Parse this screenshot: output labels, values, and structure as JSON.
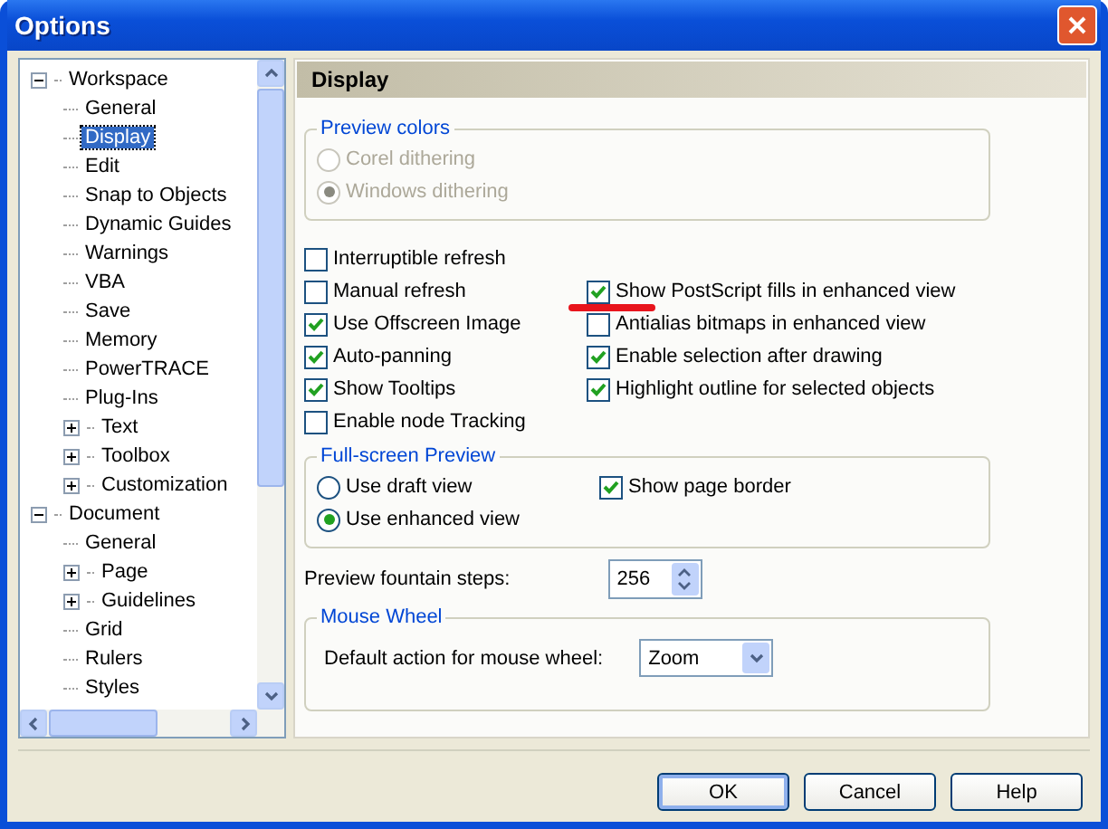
{
  "window": {
    "title": "Options"
  },
  "tree": [
    {
      "label": "Workspace",
      "expanded": true,
      "selected": false,
      "children": [
        {
          "label": "General",
          "selected": false
        },
        {
          "label": "Display",
          "selected": true
        },
        {
          "label": "Edit",
          "selected": false
        },
        {
          "label": "Snap to Objects",
          "selected": false
        },
        {
          "label": "Dynamic Guides",
          "selected": false
        },
        {
          "label": "Warnings",
          "selected": false
        },
        {
          "label": "VBA",
          "selected": false
        },
        {
          "label": "Save",
          "selected": false
        },
        {
          "label": "Memory",
          "selected": false
        },
        {
          "label": "PowerTRACE",
          "selected": false
        },
        {
          "label": "Plug-Ins",
          "selected": false
        },
        {
          "label": "Text",
          "expanded": false,
          "selected": false
        },
        {
          "label": "Toolbox",
          "expanded": false,
          "selected": false
        },
        {
          "label": "Customization",
          "expanded": false,
          "selected": false
        }
      ]
    },
    {
      "label": "Document",
      "expanded": true,
      "selected": false,
      "children": [
        {
          "label": "General",
          "selected": false
        },
        {
          "label": "Page",
          "expanded": false,
          "selected": false
        },
        {
          "label": "Guidelines",
          "expanded": false,
          "selected": false
        },
        {
          "label": "Grid",
          "selected": false
        },
        {
          "label": "Rulers",
          "selected": false
        },
        {
          "label": "Styles",
          "selected": false
        }
      ]
    }
  ],
  "panel": {
    "title": "Display",
    "preview_colors": {
      "title": "Preview colors",
      "options": [
        {
          "label": "Corel dithering",
          "selected": false,
          "disabled": true
        },
        {
          "label": "Windows dithering",
          "selected": true,
          "disabled": true
        }
      ]
    },
    "checkboxes_left": [
      {
        "label": "Interruptible refresh",
        "checked": false
      },
      {
        "label": "Manual refresh",
        "checked": false
      },
      {
        "label": "Use Offscreen Image",
        "checked": true
      },
      {
        "label": "Auto-panning",
        "checked": true
      },
      {
        "label": "Show Tooltips",
        "checked": true
      },
      {
        "label": "Enable node Tracking",
        "checked": false
      }
    ],
    "checkboxes_right": [
      {
        "label": "Show PostScript fills in enhanced view",
        "checked": true,
        "highlighted": true
      },
      {
        "label": "Antialias bitmaps in enhanced view",
        "checked": false,
        "highlighted": false
      },
      {
        "label": "Enable selection after drawing",
        "checked": true,
        "highlighted": false
      },
      {
        "label": "Highlight outline for selected objects",
        "checked": true,
        "highlighted": false
      }
    ],
    "full_screen_preview": {
      "title": "Full-screen Preview",
      "options": [
        {
          "label": "Use draft view",
          "selected": false
        },
        {
          "label": "Use enhanced view",
          "selected": true
        }
      ],
      "show_page_border": {
        "label": "Show page border",
        "checked": true
      }
    },
    "fountain_steps": {
      "label": "Preview fountain steps:",
      "value": "256"
    },
    "mouse_wheel": {
      "title": "Mouse Wheel",
      "label": "Default action for mouse wheel:",
      "value": "Zoom"
    }
  },
  "buttons": [
    {
      "label": "OK",
      "default": true
    },
    {
      "label": "Cancel",
      "default": false
    },
    {
      "label": "Help",
      "default": false
    }
  ]
}
